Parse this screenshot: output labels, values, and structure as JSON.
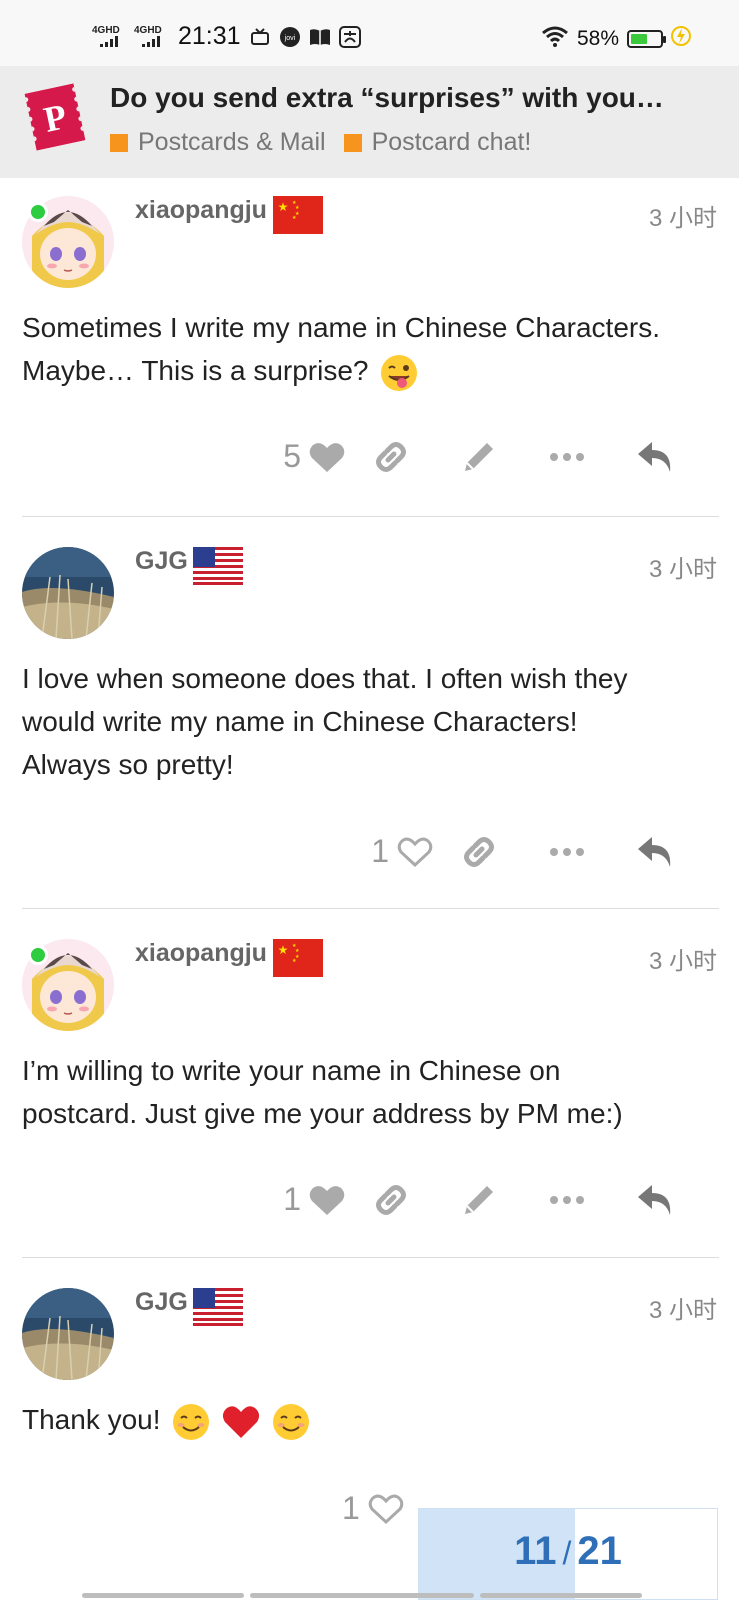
{
  "status_bar": {
    "signal1": "4GHD",
    "signal2": "4GHD",
    "time": "21:31",
    "battery_pct": "58%",
    "battery_level": 0.58
  },
  "header": {
    "title": "Do you send extra “surprises” with you…",
    "categories": [
      {
        "name": "Postcards & Mail",
        "color": "#f7941d"
      },
      {
        "name": "Postcard chat!",
        "color": "#f7941d"
      }
    ]
  },
  "posts": [
    {
      "username": "xiaopangju",
      "flag": "china-flag",
      "time": "3 小时",
      "lines": [
        "Sometimes I write my name in Chinese Characters.",
        "Maybe… This is a surprise?"
      ],
      "emoji": [
        "winking-tongue-emoji"
      ],
      "likes": "5"
    },
    {
      "username": "GJG",
      "flag": "usa-flag",
      "time": "3 小时",
      "lines": [
        "I love when someone does that. I often wish they",
        "would write my name in Chinese Characters!",
        "Always so pretty!"
      ],
      "likes": "1"
    },
    {
      "username": "xiaopangju",
      "flag": "china-flag",
      "time": "3 小时",
      "lines": [
        "I’m willing to write your name in Chinese on",
        "postcard. Just give me your address by PM me:)"
      ],
      "likes": "1"
    },
    {
      "username": "GJG",
      "flag": "usa-flag",
      "time": "3 小时",
      "lines": [
        "Thank you!"
      ],
      "emoji": [
        "smiling-face-emoji",
        "red-heart-emoji",
        "smiling-face-emoji"
      ],
      "likes": "1"
    }
  ],
  "progress": {
    "current": "11",
    "total": "21",
    "fraction": 0.524
  },
  "colors": {
    "category": "#f7941d",
    "progress_text": "#2e6fb7",
    "progress_fill": "#d1e4f7",
    "online": "#2ecc40"
  }
}
